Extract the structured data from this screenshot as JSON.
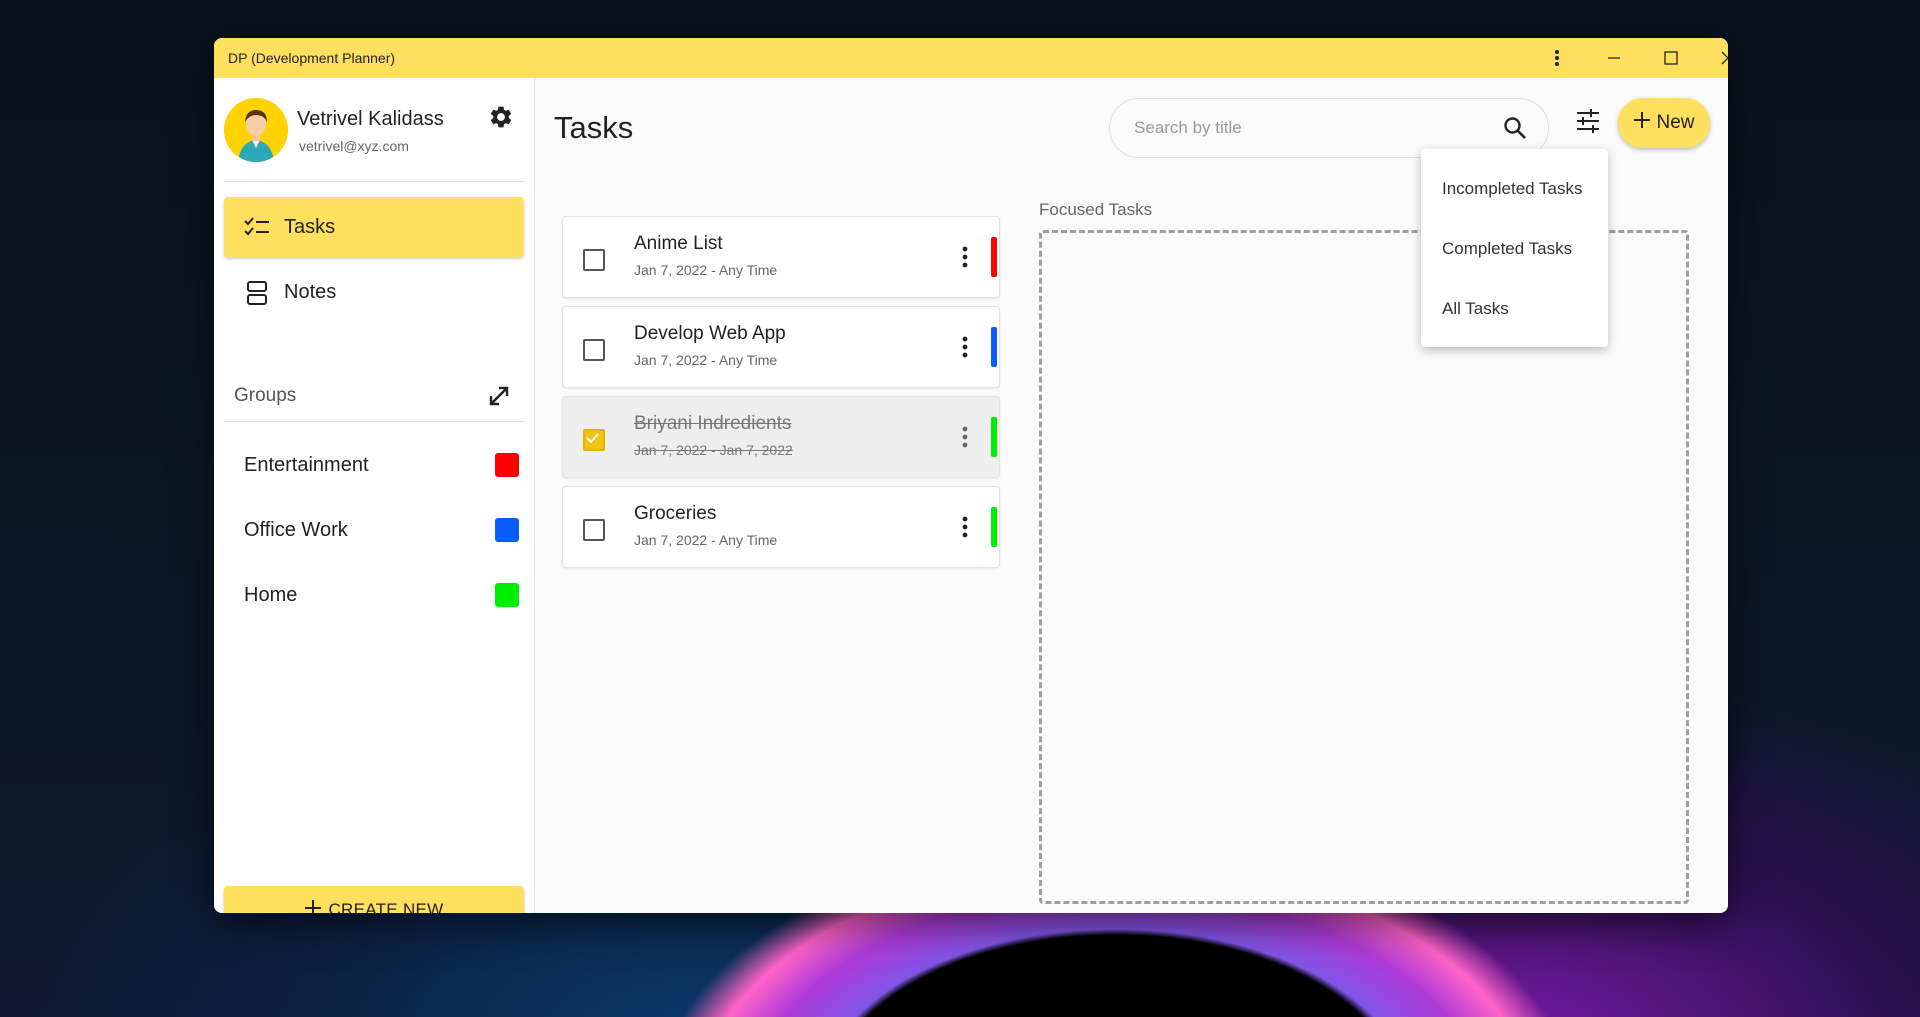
{
  "window": {
    "title": "DP (Development Planner)"
  },
  "user": {
    "name": "Vetrivel Kalidass",
    "email": "vetrivel@xyz.com"
  },
  "nav": [
    {
      "label": "Tasks",
      "icon": "checklist-icon",
      "active": true
    },
    {
      "label": "Notes",
      "icon": "notes-icon",
      "active": false
    }
  ],
  "groups": {
    "title": "Groups",
    "items": [
      {
        "label": "Entertainment",
        "color": "#ff0000"
      },
      {
        "label": "Office Work",
        "color": "#0a5cff"
      },
      {
        "label": "Home",
        "color": "#00ee00"
      }
    ]
  },
  "create_button": {
    "label": "CREATE NEW"
  },
  "main": {
    "title": "Tasks",
    "search": {
      "placeholder": "Search by title"
    },
    "new_button": "New",
    "focused_title": "Focused Tasks"
  },
  "tasks": [
    {
      "title": "Anime List",
      "date": "Jan 7, 2022 - Any Time",
      "completed": false,
      "color": "#ff0000"
    },
    {
      "title": "Develop Web App",
      "date": "Jan 7, 2022 - Any Time",
      "completed": false,
      "color": "#0a5cff"
    },
    {
      "title": "Briyani Indredients",
      "date": "Jan 7, 2022 - Jan 7, 2022",
      "completed": true,
      "color": "#00ee00"
    },
    {
      "title": "Groceries",
      "date": "Jan 7, 2022 - Any Time",
      "completed": false,
      "color": "#00ee00"
    }
  ],
  "filter_menu": {
    "options": [
      "Incompleted Tasks",
      "Completed Tasks",
      "All Tasks"
    ]
  },
  "colors": {
    "accent": "#ffdf5e"
  }
}
